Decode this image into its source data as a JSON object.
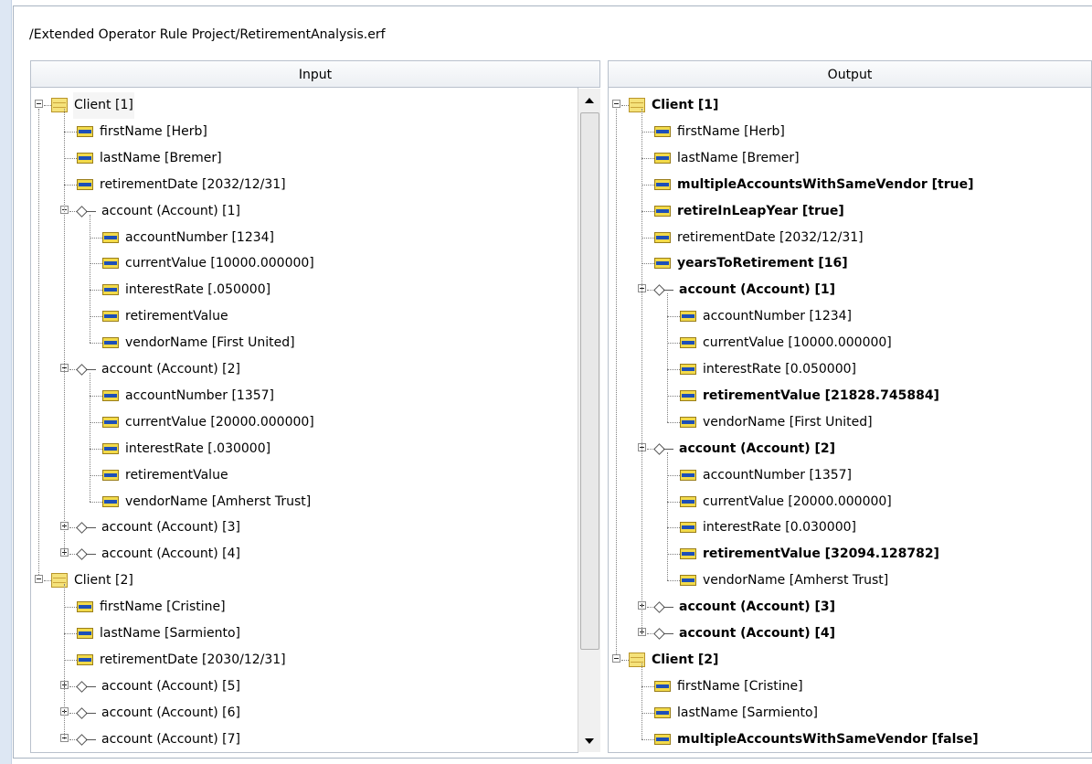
{
  "file_path": "/Extended Operator Rule Project/RetirementAnalysis.erf",
  "input_header": "Input",
  "output_header": "Output",
  "input_rows": [
    {
      "type": "client",
      "label": "Client [1]",
      "expander": "minus",
      "hl": true
    },
    {
      "type": "attr",
      "label": "firstName [Herb]"
    },
    {
      "type": "attr",
      "label": "lastName [Bremer]"
    },
    {
      "type": "attr",
      "label": "retirementDate [2032/12/31]"
    },
    {
      "type": "assoc",
      "label": "account (Account) [1]",
      "expander": "minus"
    },
    {
      "type": "attr2",
      "label": "accountNumber [1234]"
    },
    {
      "type": "attr2",
      "label": "currentValue [10000.000000]"
    },
    {
      "type": "attr2",
      "label": "interestRate [.050000]"
    },
    {
      "type": "attr2",
      "label": "retirementValue"
    },
    {
      "type": "attr2",
      "label": "vendorName [First United]"
    },
    {
      "type": "assoc",
      "label": "account (Account) [2]",
      "expander": "minus"
    },
    {
      "type": "attr2",
      "label": "accountNumber [1357]"
    },
    {
      "type": "attr2",
      "label": "currentValue [20000.000000]"
    },
    {
      "type": "attr2",
      "label": "interestRate [.030000]"
    },
    {
      "type": "attr2",
      "label": "retirementValue"
    },
    {
      "type": "attr2",
      "label": "vendorName [Amherst Trust]"
    },
    {
      "type": "assoc",
      "label": "account (Account) [3]",
      "expander": "plus"
    },
    {
      "type": "assoc",
      "label": "account (Account) [4]",
      "expander": "plus"
    },
    {
      "type": "client",
      "label": "Client [2]",
      "expander": "minus"
    },
    {
      "type": "attr",
      "label": "firstName [Cristine]"
    },
    {
      "type": "attr",
      "label": "lastName [Sarmiento]"
    },
    {
      "type": "attr",
      "label": "retirementDate [2030/12/31]"
    },
    {
      "type": "assoc",
      "label": "account (Account) [5]",
      "expander": "plus"
    },
    {
      "type": "assoc",
      "label": "account (Account) [6]",
      "expander": "plus"
    },
    {
      "type": "assoc",
      "label": "account (Account) [7]",
      "expander": "minus"
    }
  ],
  "output_rows": [
    {
      "type": "client",
      "label": "Client [1]",
      "expander": "minus",
      "bold": true
    },
    {
      "type": "attr",
      "label": "firstName [Herb]"
    },
    {
      "type": "attr",
      "label": "lastName [Bremer]"
    },
    {
      "type": "attr",
      "label": "multipleAccountsWithSameVendor [true]",
      "bold": true
    },
    {
      "type": "attr",
      "label": "retireInLeapYear [true]",
      "bold": true
    },
    {
      "type": "attr",
      "label": "retirementDate [2032/12/31]"
    },
    {
      "type": "attr",
      "label": "yearsToRetirement [16]",
      "bold": true
    },
    {
      "type": "assoc",
      "label": "account (Account) [1]",
      "expander": "minus",
      "bold": true
    },
    {
      "type": "attr2",
      "label": "accountNumber [1234]"
    },
    {
      "type": "attr2",
      "label": "currentValue [10000.000000]"
    },
    {
      "type": "attr2",
      "label": "interestRate [0.050000]"
    },
    {
      "type": "attr2",
      "label": "retirementValue [21828.745884]",
      "bold": true
    },
    {
      "type": "attr2",
      "label": "vendorName [First United]"
    },
    {
      "type": "assoc",
      "label": "account (Account) [2]",
      "expander": "minus",
      "bold": true
    },
    {
      "type": "attr2",
      "label": "accountNumber [1357]"
    },
    {
      "type": "attr2",
      "label": "currentValue [20000.000000]"
    },
    {
      "type": "attr2",
      "label": "interestRate [0.030000]"
    },
    {
      "type": "attr2",
      "label": "retirementValue [32094.128782]",
      "bold": true
    },
    {
      "type": "attr2",
      "label": "vendorName [Amherst Trust]"
    },
    {
      "type": "assoc",
      "label": "account (Account) [3]",
      "expander": "plus",
      "bold": true
    },
    {
      "type": "assoc",
      "label": "account (Account) [4]",
      "expander": "plus",
      "bold": true
    },
    {
      "type": "client",
      "label": "Client [2]",
      "expander": "minus",
      "bold": true
    },
    {
      "type": "attr",
      "label": "firstName [Cristine]"
    },
    {
      "type": "attr",
      "label": "lastName [Sarmiento]"
    },
    {
      "type": "attr",
      "label": "multipleAccountsWithSameVendor [false]",
      "bold": true
    }
  ],
  "icons": {
    "client": "entity-folder-icon",
    "attr": "attribute-icon",
    "assoc": "association-icon"
  }
}
